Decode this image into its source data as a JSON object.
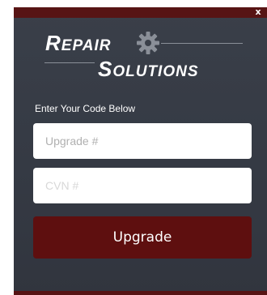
{
  "window": {
    "close_label": "x"
  },
  "logo": {
    "line1_first": "R",
    "line1_rest": "EPAIR",
    "line2_first": "S",
    "line2_rest": "OLUTIONS",
    "icon": "gear-icon"
  },
  "form": {
    "prompt": "Enter Your Code Below",
    "upgrade_placeholder": "Upgrade #",
    "cvn_placeholder": "CVN #",
    "submit_label": "Upgrade"
  },
  "colors": {
    "titlebar": "#571414",
    "background": "#383d47",
    "button": "#5e0f0f",
    "text": "#ffffff"
  }
}
